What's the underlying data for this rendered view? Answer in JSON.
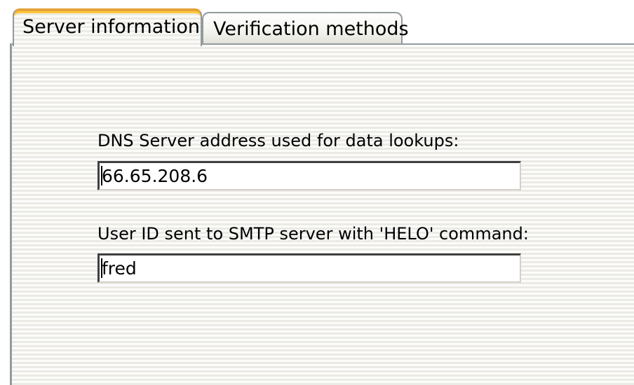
{
  "tabs": [
    {
      "label": "Server information",
      "active": true
    },
    {
      "label": "Verification methods",
      "active": false
    }
  ],
  "dns": {
    "label": "DNS Server address used for data lookups:",
    "value": "66.65.208.6"
  },
  "helo": {
    "label": "User ID sent to SMTP server with 'HELO' command:",
    "value": "fred"
  },
  "colors": {
    "tab_highlight": "#e4a23a",
    "border": "#919b9c",
    "panel_stripe_light": "#fcfcfb",
    "panel_stripe_dark": "#ebeae5"
  }
}
